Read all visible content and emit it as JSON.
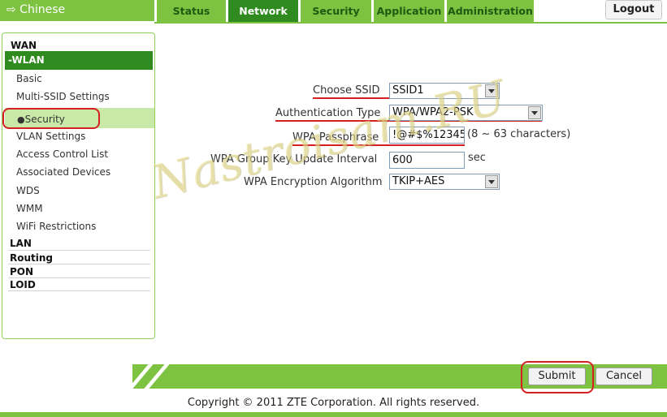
{
  "header": {
    "language_label": "⇨ Chinese",
    "tabs": [
      {
        "label": "Status"
      },
      {
        "label": "Network"
      },
      {
        "label": "Security"
      },
      {
        "label": "Application"
      },
      {
        "label": "Administration"
      }
    ],
    "active_tab": "Network",
    "logout_label": "Logout"
  },
  "sidebar": {
    "wan": "WAN",
    "wlan": "-WLAN",
    "items": [
      {
        "label": "Basic"
      },
      {
        "label": "Multi-SSID Settings"
      },
      {
        "label": "Security"
      },
      {
        "label": "VLAN Settings"
      },
      {
        "label": "Access Control List"
      },
      {
        "label": "Associated Devices"
      },
      {
        "label": "WDS"
      },
      {
        "label": "WMM"
      },
      {
        "label": "WiFi Restrictions"
      }
    ],
    "selected_item": "Security",
    "sections": [
      {
        "label": "LAN"
      },
      {
        "label": "Routing"
      },
      {
        "label": "PON"
      },
      {
        "label": "LOID"
      }
    ]
  },
  "form": {
    "ssid_label": "Choose SSID",
    "ssid_value": "SSID1",
    "auth_label": "Authentication Type",
    "auth_value": "WPA/WPA2-PSK",
    "passphrase_label": "WPA Passphrase",
    "passphrase_value": "!@#$%12345",
    "passphrase_hint": "(8 ~ 63 characters)",
    "group_key_label": "WPA Group Key Update Interval",
    "group_key_value": "600",
    "group_key_unit": "sec",
    "encryption_label": "WPA Encryption Algorithm",
    "encryption_value": "TKIP+AES"
  },
  "watermark": "Nastroisam.RU",
  "buttons": {
    "submit": "Submit",
    "cancel": "Cancel"
  },
  "footer": {
    "copyright": "Copyright © 2011 ZTE Corporation. All rights reserved."
  },
  "colors": {
    "brand_green": "#7dc241",
    "active_green": "#2f8a1f",
    "annotation_red": "#d42020"
  }
}
